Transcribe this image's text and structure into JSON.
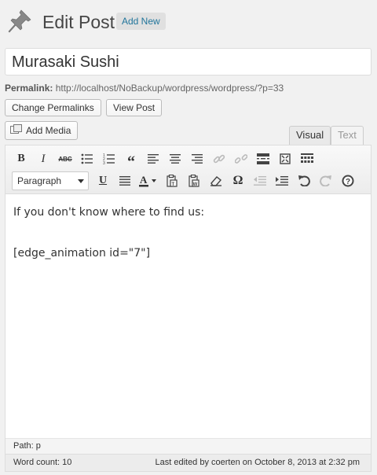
{
  "header": {
    "title": "Edit Post",
    "add_new_label": "Add New"
  },
  "post": {
    "title": "Murasaki Sushi",
    "permalink_label": "Permalink:",
    "permalink_url": "http://localhost/NoBackup/wordpress/wordpress/?p=33"
  },
  "buttons": {
    "change_permalinks": "Change Permalinks",
    "view_post": "View Post",
    "add_media": "Add Media"
  },
  "tabs": {
    "visual": "Visual",
    "text": "Text"
  },
  "toolbar": {
    "row1": [
      "bold-icon",
      "italic-icon",
      "strikethrough-icon",
      "bullet-list-icon",
      "numbered-list-icon",
      "blockquote-icon",
      "align-left-icon",
      "align-center-icon",
      "align-right-icon",
      "link-icon",
      "unlink-icon",
      "more-tag-icon",
      "fullscreen-icon",
      "kitchen-sink-icon"
    ],
    "row2": [
      "underline-icon",
      "justify-icon",
      "text-color-icon",
      "paste-text-icon",
      "paste-word-icon",
      "clear-format-icon",
      "special-char-icon",
      "outdent-icon",
      "indent-icon",
      "undo-icon",
      "redo-icon",
      "help-icon"
    ],
    "format_value": "Paragraph"
  },
  "content": {
    "line1": "If you don't know where to find us:",
    "line2": "[edge_animation id=\"7\"]"
  },
  "status": {
    "path": "Path: p",
    "word_count": "Word count: 10",
    "last_edited": "Last edited by coerten on October 8, 2013 at 2:32 pm"
  },
  "colors": {
    "link_blue": "#21759b",
    "background": "#f1f1f1"
  }
}
